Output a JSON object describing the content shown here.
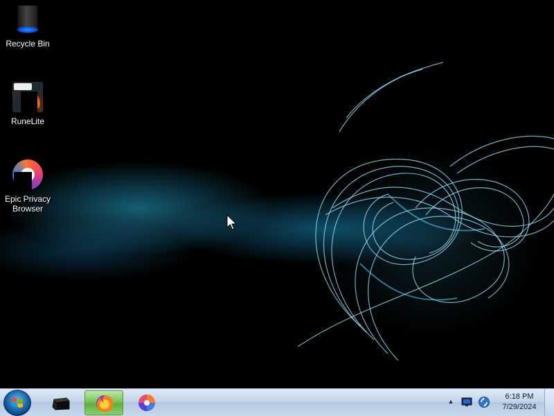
{
  "desktop": {
    "icons": [
      {
        "label": "Recycle Bin",
        "icon": "recycle-bin-icon"
      },
      {
        "label": "RuneLite",
        "icon": "runelite-icon"
      },
      {
        "label": "Epic Privacy Browser",
        "icon": "epic-browser-icon"
      }
    ]
  },
  "taskbar": {
    "start": {
      "icon": "windows-start-icon"
    },
    "pinned": [
      {
        "app": "terminal",
        "icon": "terminal-icon",
        "active": false
      },
      {
        "app": "firefox",
        "icon": "firefox-icon",
        "active": true
      },
      {
        "app": "epic-browser",
        "icon": "epic-browser-icon",
        "active": false
      }
    ],
    "tray": {
      "icons": [
        "show-hidden-icons-icon",
        "action-center-icon",
        "network-icon"
      ]
    },
    "clock": {
      "time": "6:18 PM",
      "date": "7/29/2024"
    }
  },
  "colors": {
    "wallpaper_accent": "#38b6e0",
    "taskbar_active": "#79c35a"
  }
}
